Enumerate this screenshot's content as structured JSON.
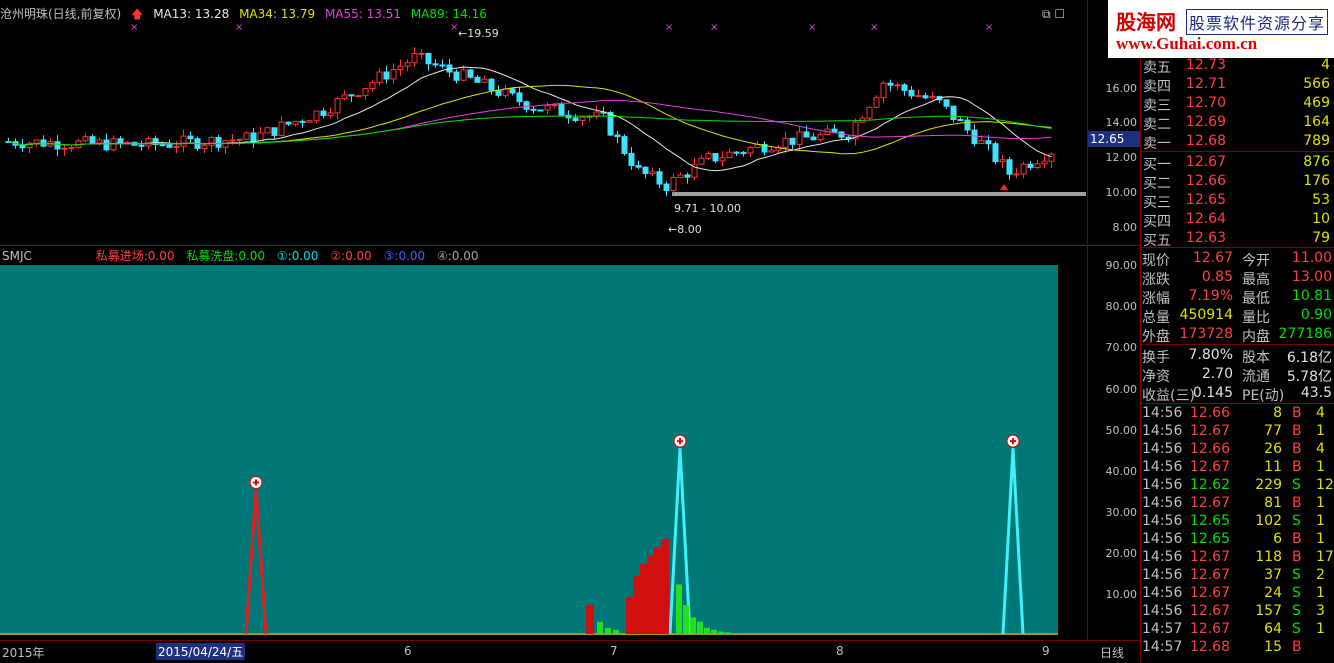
{
  "header": {
    "title": "沧州明珠(日线,前复权)",
    "ma13": "MA13: 13.28",
    "ma34": "MA34: 13.79",
    "ma55": "MA55: 13.51",
    "ma89": "MA89: 14.16",
    "ma13_color": "#e8e8e8",
    "ma34_color": "#e0e000",
    "ma55_color": "#e040e0",
    "ma89_color": "#00e000"
  },
  "price_axis": [
    "16.00",
    "14.00",
    "12.00",
    "10.00",
    "8.00"
  ],
  "price_annotations": {
    "high": "19.59",
    "range": "9.71 - 10.00",
    "low": "8.00",
    "current_tag": "12.65"
  },
  "indicator": {
    "name": "SMJC",
    "items": [
      {
        "label": "私募进场:",
        "value": "0.00",
        "color": "#ff4040"
      },
      {
        "label": "私募洗盘:",
        "value": "0.00",
        "color": "#00e000"
      },
      {
        "label": "①:",
        "value": "0.00",
        "color": "#00e0e0"
      },
      {
        "label": "②:",
        "value": "0.00",
        "color": "#ff4040"
      },
      {
        "label": "③:",
        "value": "0.00",
        "color": "#4060ff"
      },
      {
        "label": "④:",
        "value": "0.00",
        "color": "#a0a0a0"
      }
    ],
    "axis": [
      "90.00",
      "80.00",
      "70.00",
      "60.00",
      "50.00",
      "40.00",
      "30.00",
      "20.00",
      "10.00"
    ],
    "bg_color": "#007878"
  },
  "timeline": {
    "year": "2015年",
    "selected": "2015/04/24/五",
    "months": [
      "6",
      "7",
      "8",
      "9"
    ],
    "period": "日线"
  },
  "logo": {
    "line1": "股海网",
    "line1b": "股票软件资源分享",
    "line2": "www.Guhai.com.cn"
  },
  "order_book": {
    "asks": [
      {
        "label": "卖五",
        "price": "12.73",
        "vol": "4"
      },
      {
        "label": "卖四",
        "price": "12.71",
        "vol": "566"
      },
      {
        "label": "卖三",
        "price": "12.70",
        "vol": "469"
      },
      {
        "label": "卖二",
        "price": "12.69",
        "vol": "164"
      },
      {
        "label": "卖一",
        "price": "12.68",
        "vol": "789"
      }
    ],
    "bids": [
      {
        "label": "买一",
        "price": "12.67",
        "vol": "876"
      },
      {
        "label": "买二",
        "price": "12.66",
        "vol": "176"
      },
      {
        "label": "买三",
        "price": "12.65",
        "vol": "53"
      },
      {
        "label": "买四",
        "price": "12.64",
        "vol": "10"
      },
      {
        "label": "买五",
        "price": "12.63",
        "vol": "79"
      }
    ]
  },
  "quote": [
    {
      "k1": "现价",
      "v1": "12.67",
      "c1": "#ff4040",
      "k2": "今开",
      "v2": "11.00",
      "c2": "#ff4040"
    },
    {
      "k1": "涨跌",
      "v1": "0.85",
      "c1": "#ff4040",
      "k2": "最高",
      "v2": "13.00",
      "c2": "#ff4040"
    },
    {
      "k1": "涨幅",
      "v1": "7.19%",
      "c1": "#ff4040",
      "k2": "最低",
      "v2": "10.81",
      "c2": "#00e000"
    },
    {
      "k1": "总量",
      "v1": "450914",
      "c1": "#e0e000",
      "k2": "量比",
      "v2": "0.90",
      "c2": "#00e000"
    },
    {
      "k1": "外盘",
      "v1": "173728",
      "c1": "#ff4040",
      "k2": "内盘",
      "v2": "277186",
      "c2": "#00e000"
    }
  ],
  "fundamentals": [
    {
      "k1": "换手",
      "v1": "7.80%",
      "k2": "股本",
      "v2": "6.18亿"
    },
    {
      "k1": "净资",
      "v1": "2.70",
      "k2": "流通",
      "v2": "5.78亿"
    },
    {
      "k1": "收益(三)",
      "v1": "0.145",
      "k2": "PE(动)",
      "v2": "43.5"
    }
  ],
  "trades": [
    {
      "t": "14:56",
      "p": "12.66",
      "v": "8",
      "d": "B",
      "x": "4"
    },
    {
      "t": "14:56",
      "p": "12.67",
      "v": "77",
      "d": "B",
      "x": "1"
    },
    {
      "t": "14:56",
      "p": "12.66",
      "v": "26",
      "d": "B",
      "x": "4"
    },
    {
      "t": "14:56",
      "p": "12.67",
      "v": "11",
      "d": "B",
      "x": "1"
    },
    {
      "t": "14:56",
      "p": "12.62",
      "v": "229",
      "d": "S",
      "x": "12"
    },
    {
      "t": "14:56",
      "p": "12.67",
      "v": "81",
      "d": "B",
      "x": "1"
    },
    {
      "t": "14:56",
      "p": "12.65",
      "v": "102",
      "d": "S",
      "x": "1"
    },
    {
      "t": "14:56",
      "p": "12.65",
      "v": "6",
      "d": "B",
      "x": "1"
    },
    {
      "t": "14:56",
      "p": "12.67",
      "v": "118",
      "d": "B",
      "x": "17"
    },
    {
      "t": "14:56",
      "p": "12.67",
      "v": "37",
      "d": "S",
      "x": "2"
    },
    {
      "t": "14:56",
      "p": "12.67",
      "v": "24",
      "d": "S",
      "x": "1"
    },
    {
      "t": "14:56",
      "p": "12.67",
      "v": "157",
      "d": "S",
      "x": "3"
    },
    {
      "t": "14:57",
      "p": "12.67",
      "v": "64",
      "d": "S",
      "x": "1"
    },
    {
      "t": "14:57",
      "p": "12.68",
      "v": "15",
      "d": "B",
      "x": ""
    }
  ]
}
